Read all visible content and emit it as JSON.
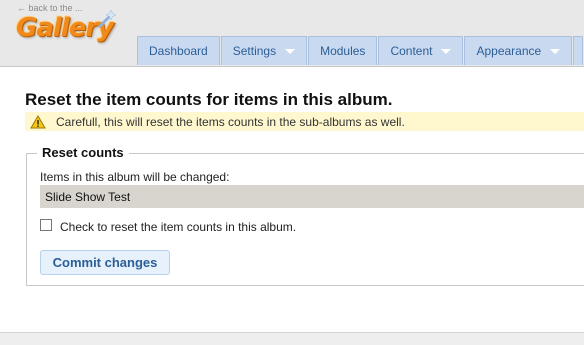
{
  "header": {
    "back_link": "← back to the ...",
    "logo_text": "Gallery",
    "nav": [
      {
        "label": "Dashboard",
        "dropdown": false
      },
      {
        "label": "Settings",
        "dropdown": true
      },
      {
        "label": "Modules",
        "dropdown": false
      },
      {
        "label": "Content",
        "dropdown": true
      },
      {
        "label": "Appearance",
        "dropdown": true
      }
    ]
  },
  "main": {
    "title": "Reset the item counts for items in this album.",
    "warning": "Carefull, this will reset the items counts in the sub-albums as well.",
    "form": {
      "legend": "Reset counts",
      "items_label": "Items in this album will be changed:",
      "album_name": "Slide Show Test",
      "checkbox_label": "Check to reset the item counts in this album.",
      "checkbox_checked": false,
      "submit_label": "Commit changes"
    }
  },
  "colors": {
    "nav_bg": "#c9daf0",
    "nav_text": "#2c5e97",
    "logo": "#f08a1c",
    "warning_bg": "#fff8cf",
    "field_bg": "#d8d5ce",
    "button_bg": "#e6f1fb"
  }
}
